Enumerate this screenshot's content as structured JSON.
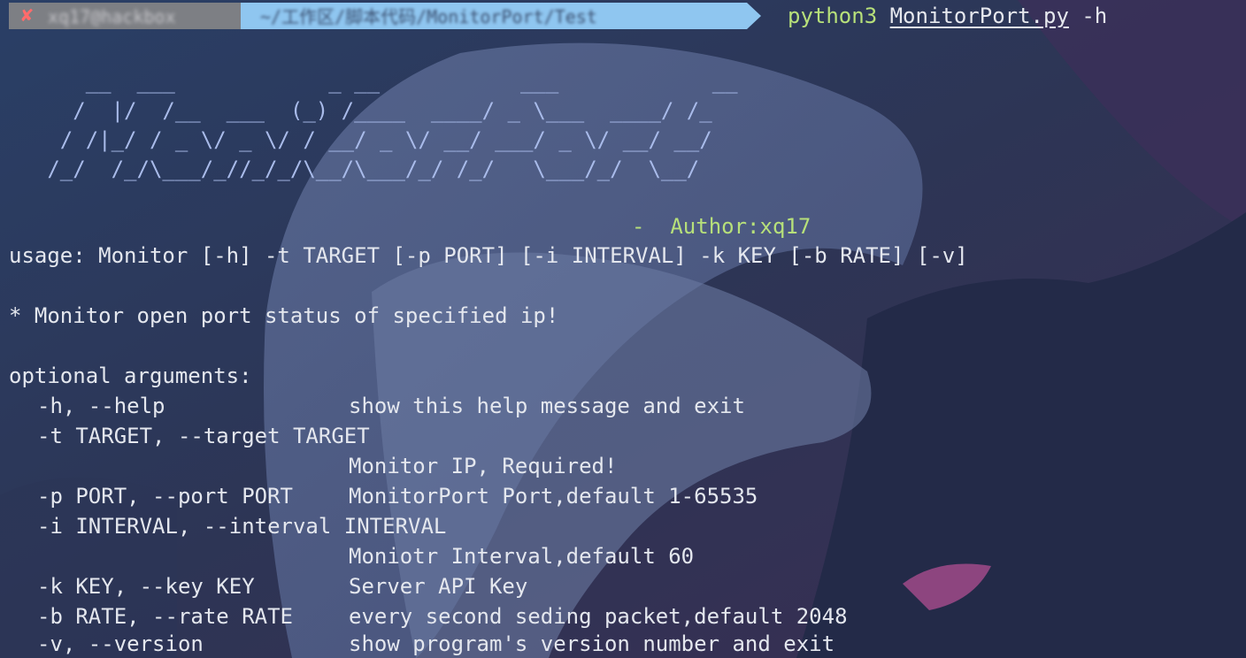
{
  "prompt": {
    "status_icon": "cross-icon",
    "user_host": "xq17@hackbox",
    "path": "~/工作区/脚本代码/MonitorPort/Test",
    "command_exe": "python3",
    "command_file": "MonitorPort.py",
    "command_args": "-h"
  },
  "banner": {
    "lines": [
      "      __  ___            _ __           ___            __",
      "     /  |/  /__  ___  (_) /____  ____/ _ \\___  ____/ /_",
      "    / /|_/ / _ \\/ _ \\/ / __/ _ \\/ __/ ___/ _ \\/ __/ __/",
      "   /_/  /_/\\___/_//_/_/\\__/\\___/_/ /_/   \\___/_/  \\__/"
    ],
    "author": "-  Author:xq17"
  },
  "help": {
    "usage": "usage: Monitor [-h] -t TARGET [-p PORT] [-i INTERVAL] -k KEY [-b RATE] [-v]",
    "description": "* Monitor open port status of specified ip!",
    "section_title": "optional arguments:",
    "options": [
      {
        "flag": "-h, --help",
        "desc": "show this help message and exit"
      },
      {
        "flag": "-t TARGET, --target TARGET",
        "desc": "Monitor IP, Required!"
      },
      {
        "flag": "-p PORT, --port PORT",
        "desc": "MonitorPort Port,default 1-65535"
      },
      {
        "flag": "-i INTERVAL, --interval INTERVAL",
        "desc": "Moniotr Interval,default 60"
      },
      {
        "flag": "-k KEY, --key KEY",
        "desc": "Server API Key"
      },
      {
        "flag": "-b RATE, --rate RATE",
        "desc": "every second seding packet,default 2048"
      },
      {
        "flag": "-v, --version",
        "desc": "show program's version number and exit"
      }
    ]
  }
}
